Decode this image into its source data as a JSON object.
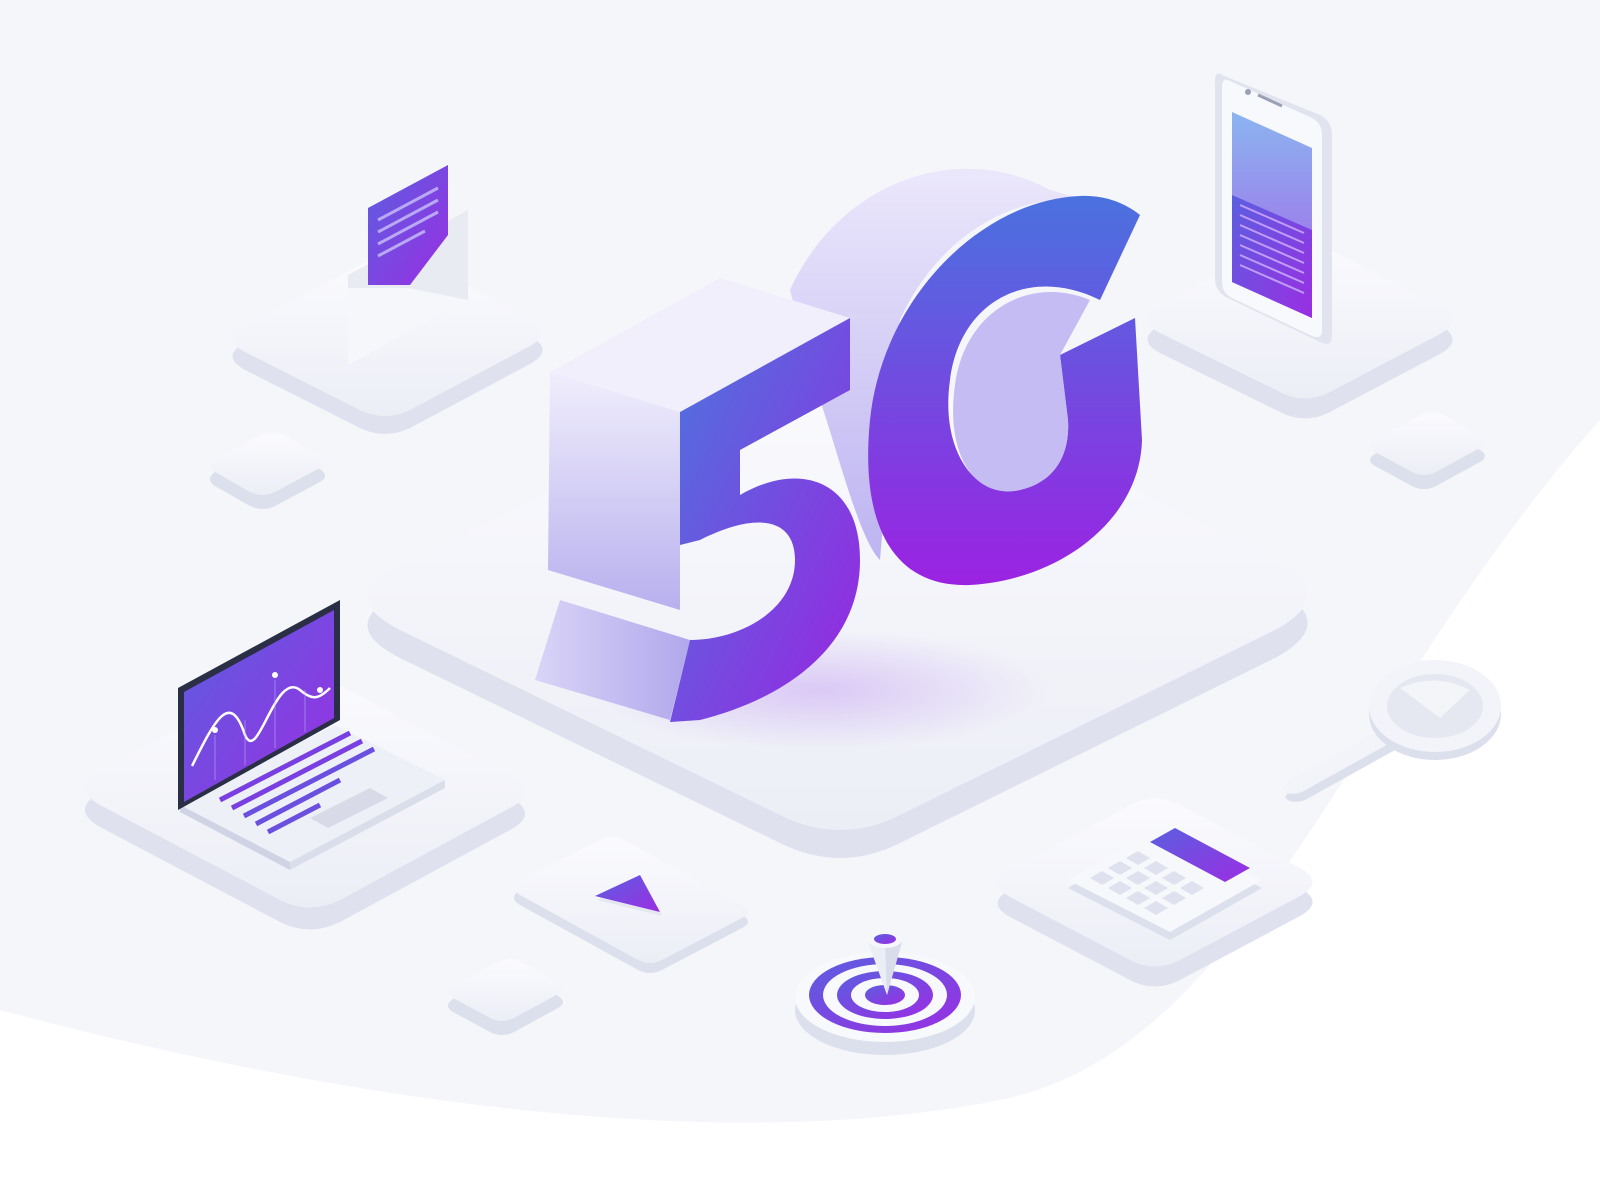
{
  "illustration": {
    "headline": "5G",
    "palette": {
      "background_light": "#f4f5fa",
      "background_white": "#ffffff",
      "tile_top": "#f7f8fc",
      "tile_side": "#e4e6f1",
      "accent_blue": "#4a6fe0",
      "accent_purple": "#9b22e0",
      "accent_violet": "#6a3fe0",
      "extrusion_lavender": "#c9c3f3"
    },
    "icons": [
      "envelope-icon",
      "smartphone-icon",
      "laptop-icon",
      "play-icon",
      "target-icon",
      "calculator-icon",
      "magnifier-icon"
    ]
  }
}
